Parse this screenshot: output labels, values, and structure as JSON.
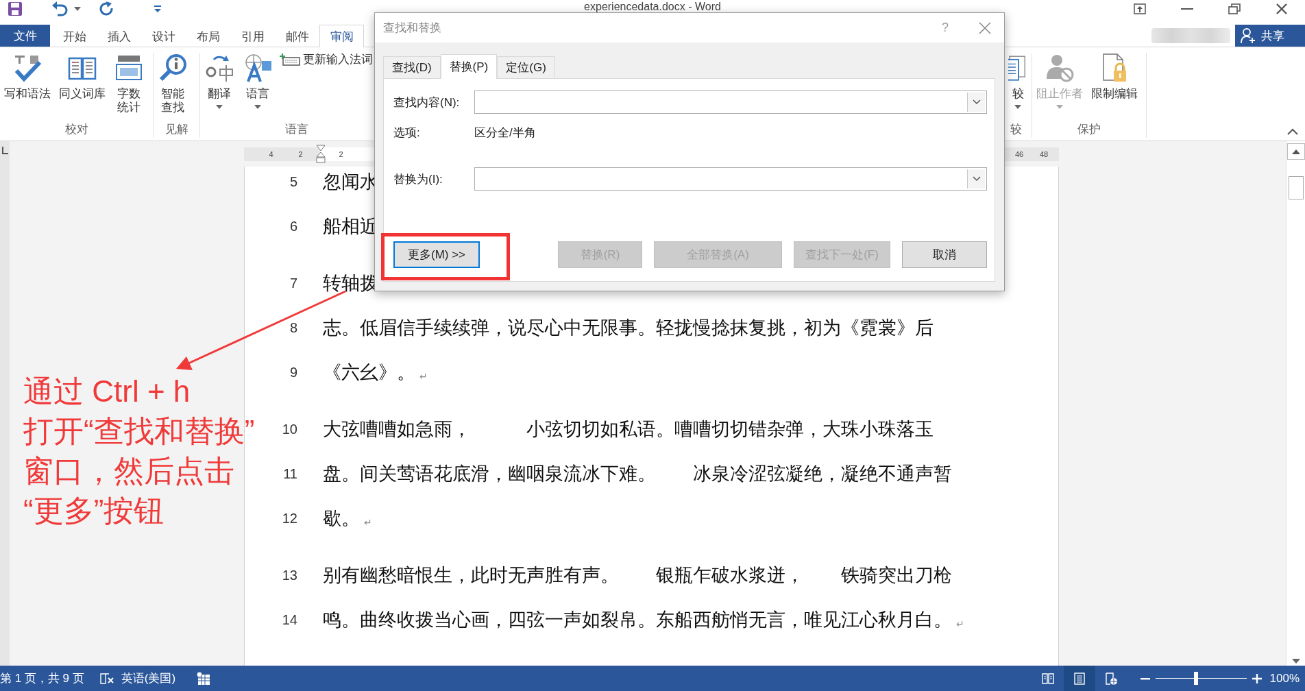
{
  "window": {
    "title": "experiencedata.docx - Word"
  },
  "ribbon_tabs": [
    {
      "label": "文件",
      "kind": "file",
      "selected": false
    },
    {
      "label": "开始",
      "kind": "tab",
      "selected": false
    },
    {
      "label": "插入",
      "kind": "tab",
      "selected": false
    },
    {
      "label": "设计",
      "kind": "tab",
      "selected": false
    },
    {
      "label": "布局",
      "kind": "tab",
      "selected": false
    },
    {
      "label": "引用",
      "kind": "tab",
      "selected": false
    },
    {
      "label": "邮件",
      "kind": "tab",
      "selected": false
    },
    {
      "label": "审阅",
      "kind": "tab",
      "selected": true
    }
  ],
  "share_button": {
    "label": "共享"
  },
  "ribbon_groups": [
    {
      "label": "校对",
      "commands": [
        {
          "label": "写和语法",
          "kind": "large",
          "dropdown": false,
          "disabled": false
        },
        {
          "label": "同义词库",
          "kind": "large",
          "dropdown": false,
          "disabled": false
        },
        {
          "label": "字数统计",
          "kind": "large",
          "dropdown": false,
          "disabled": false
        }
      ]
    },
    {
      "label": "见解",
      "commands": [
        {
          "label": "智能查找",
          "kind": "large",
          "dropdown": false,
          "disabled": false
        }
      ]
    },
    {
      "label": "语言",
      "commands": [
        {
          "label": "翻译",
          "kind": "large",
          "dropdown": true,
          "disabled": false
        },
        {
          "label": "语言",
          "kind": "large",
          "dropdown": true,
          "disabled": false
        },
        {
          "label": "更新输入法词",
          "kind": "small",
          "dropdown": false,
          "disabled": false
        }
      ]
    },
    {
      "label": "较",
      "commands": [
        {
          "label": "较",
          "kind": "large",
          "dropdown": true,
          "disabled": false
        }
      ]
    },
    {
      "label": "保护",
      "commands": [
        {
          "label": "阻止作者",
          "kind": "large",
          "dropdown": true,
          "disabled": true
        },
        {
          "label": "限制编辑",
          "kind": "large",
          "dropdown": false,
          "disabled": false
        }
      ]
    }
  ],
  "ruler": {
    "left_numbers": [
      "4",
      "2",
      "2"
    ],
    "right_numbers": [
      "46",
      "48"
    ]
  },
  "paragraphs": [
    {
      "lines": [
        {
          "number": "5",
          "text": "忽闻水"
        },
        {
          "number": "6",
          "text": "船相近"
        }
      ]
    },
    {
      "lines": [
        {
          "number": "7",
          "text": "转轴拨"
        },
        {
          "number": "8",
          "text": "志。低眉信手续续弹，说尽心中无限事。轻拢慢捻抹复挑，初为《霓裳》后"
        },
        {
          "number": "9",
          "text": "《六幺》。",
          "end_mark": "↵"
        }
      ]
    },
    {
      "lines": [
        {
          "number": "10",
          "text": "大弦嘈嘈如急雨，　　　小弦切切如私语。嘈嘈切切错杂弹，大珠小珠落玉"
        },
        {
          "number": "11",
          "text": "盘。间关莺语花底滑，幽咽泉流冰下难。　　冰泉冷涩弦凝绝，凝绝不通声暂"
        },
        {
          "number": "12",
          "text": "歇。",
          "end_mark": "↵"
        }
      ]
    },
    {
      "lines": [
        {
          "number": "13",
          "text": "别有幽愁暗恨生，此时无声胜有声。　　银瓶乍破水浆迸，　　铁骑突出刀枪"
        },
        {
          "number": "14",
          "text": "鸣。曲终收拨当心画，四弦一声如裂帛。东船西舫悄无言，唯见江心秋月白。",
          "end_mark": "↵"
        }
      ]
    }
  ],
  "dialog": {
    "title": "查找和替换",
    "help": "?",
    "tabs": [
      {
        "label": "查找(D)",
        "selected": false
      },
      {
        "label": "替换(P)",
        "selected": true
      },
      {
        "label": "定位(G)",
        "selected": false
      }
    ],
    "find_label": "查找内容(N):",
    "options_label": "选项:",
    "options_value": "区分全/半角",
    "replace_label": "替换为(I):",
    "buttons": [
      {
        "label": "更多(M) >>",
        "disabled": false,
        "focused": true
      },
      {
        "label": "替换(R)",
        "disabled": true,
        "focused": false
      },
      {
        "label": "全部替换(A)",
        "disabled": true,
        "focused": false
      },
      {
        "label": "查找下一处(F)",
        "disabled": true,
        "focused": false
      },
      {
        "label": "取消",
        "disabled": false,
        "focused": false
      }
    ]
  },
  "annotation": {
    "lines": [
      "通过 Ctrl + h",
      "打开“查找和替换”",
      "窗口，然后点击",
      "“更多”按钮"
    ]
  },
  "status_bar": {
    "page_info": "第 1 页，共 9 页",
    "language": "英语(美国)",
    "views": [
      {
        "selected": false
      },
      {
        "selected": true
      },
      {
        "selected": false
      }
    ],
    "zoom": {
      "level": 0.45,
      "reading": "100%"
    }
  }
}
